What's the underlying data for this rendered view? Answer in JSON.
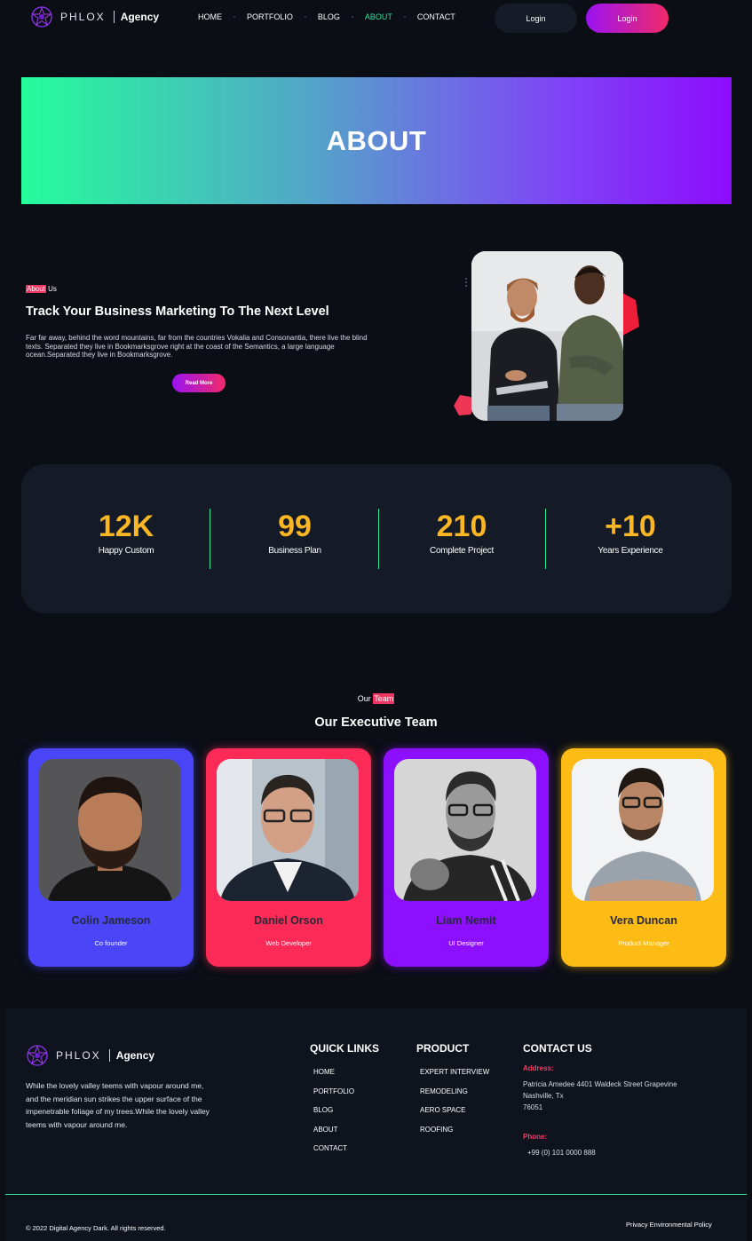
{
  "header": {
    "logo_name": "PHLOX",
    "logo_agency": "Agency",
    "nav": [
      {
        "label": "HOME",
        "active": false
      },
      {
        "label": "PORTFOLIO",
        "active": false
      },
      {
        "label": "BLOG",
        "active": false
      },
      {
        "label": "ABOUT",
        "active": true
      },
      {
        "label": "CONTACT",
        "active": false
      }
    ],
    "login_dark": "Login",
    "login_gradient": "Login"
  },
  "banner": {
    "title": "ABOUT"
  },
  "about": {
    "tag_highlight": "About",
    "tag_rest": " Us",
    "title": "Track Your Business Marketing To The Next Level",
    "text": "Far far away, behind the word mountains, far from the countries Vokalia and Consonantia, there live the blind texts. Separated they live in Bookmarksgrove right at the coast of the Semantics, a large language ocean.Separated they live in Bookmarksgrove.",
    "button": "Read More"
  },
  "stats": [
    {
      "value": "12K",
      "label": "Happy Custom"
    },
    {
      "value": "99",
      "label": "Business Plan"
    },
    {
      "value": "210",
      "label": "Complete Project"
    },
    {
      "value": "+10",
      "label": "Years Experience"
    }
  ],
  "team": {
    "tag_prefix": "Our ",
    "tag_highlight": "Team",
    "title": "Our Executive Team",
    "members": [
      {
        "name": "Colin Jameson",
        "role": "Co founder",
        "color": "#4a46f7"
      },
      {
        "name": "Daniel Orson",
        "role": "Web Developer",
        "color": "#fb2a57"
      },
      {
        "name": "Liam Nemit",
        "role": "UI Designer",
        "color": "#8c10fd"
      },
      {
        "name": "Vera Duncan",
        "role": "Product Manager",
        "color": "#fdbb15"
      }
    ]
  },
  "footer": {
    "logo_name": "PHLOX",
    "logo_agency": "Agency",
    "description": "While the lovely valley teems with vapour around me, and the meridian sun strikes the upper surface of the impenetrable foliage of my trees.While the lovely valley teems with vapour around me.",
    "quick_links_title": "QUICK LINKS",
    "quick_links": [
      "HOME",
      "PORTFOLIO",
      "BLOG",
      "ABOUT",
      "CONTACT"
    ],
    "product_title": "PRODUCT",
    "product_links": [
      "EXPERT INTERVIEW",
      "REMODELING",
      "AERO SPACE",
      "ROOFING"
    ],
    "contact_title": "CONTACT US",
    "address_label": "Address:",
    "address_line1": "Patricia Amedee 4401 Waldeck Street Grapevine",
    "address_line2": "Nashville, Tx",
    "address_line3": "76051",
    "phone_label": "Phone:",
    "phone": "+99 (0) 101 0000 888",
    "copyright": "© 2022 Digital Agency Dark. All rights reserved.",
    "policy": "Privacy Environmental Policy"
  },
  "colors": {
    "accent_green": "#2fe89c",
    "accent_pink": "#ee3663",
    "accent_purple": "#9b13f2",
    "stat_yellow": "#fbb624",
    "background": "#0b0e15"
  }
}
